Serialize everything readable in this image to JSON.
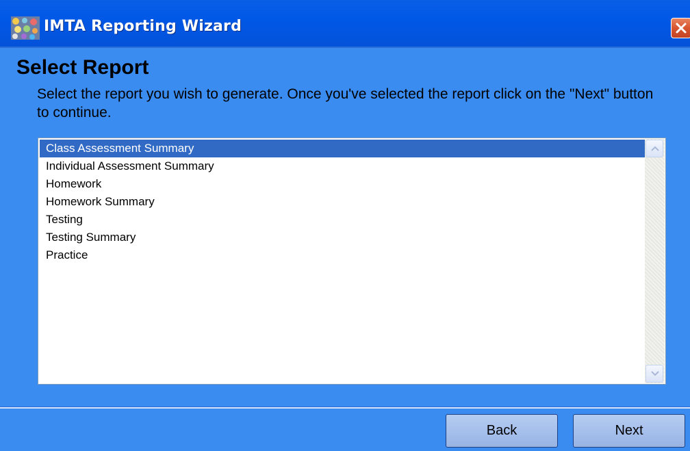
{
  "window": {
    "title": "IMTA Reporting Wizard"
  },
  "page": {
    "heading": "Select Report",
    "instructions": "Select the report you wish to generate. Once you've selected the report click on the \"Next\" button to continue."
  },
  "report_list": {
    "selected_index": 0,
    "items": [
      {
        "label": "Class Assessment Summary"
      },
      {
        "label": "Individual Assessment Summary"
      },
      {
        "label": "Homework"
      },
      {
        "label": "Homework Summary"
      },
      {
        "label": "Testing"
      },
      {
        "label": "Testing Summary"
      },
      {
        "label": "Practice"
      }
    ]
  },
  "buttons": {
    "back": "Back",
    "next": "Next"
  },
  "icons": {
    "app": "app-icon",
    "close": "close-icon",
    "scroll_up": "scroll-up-icon",
    "scroll_down": "scroll-down-icon"
  },
  "colors": {
    "titlebar": "#0058e6",
    "background": "#3a8cf0",
    "selection": "#316ac5",
    "close_button": "#d8552e"
  }
}
